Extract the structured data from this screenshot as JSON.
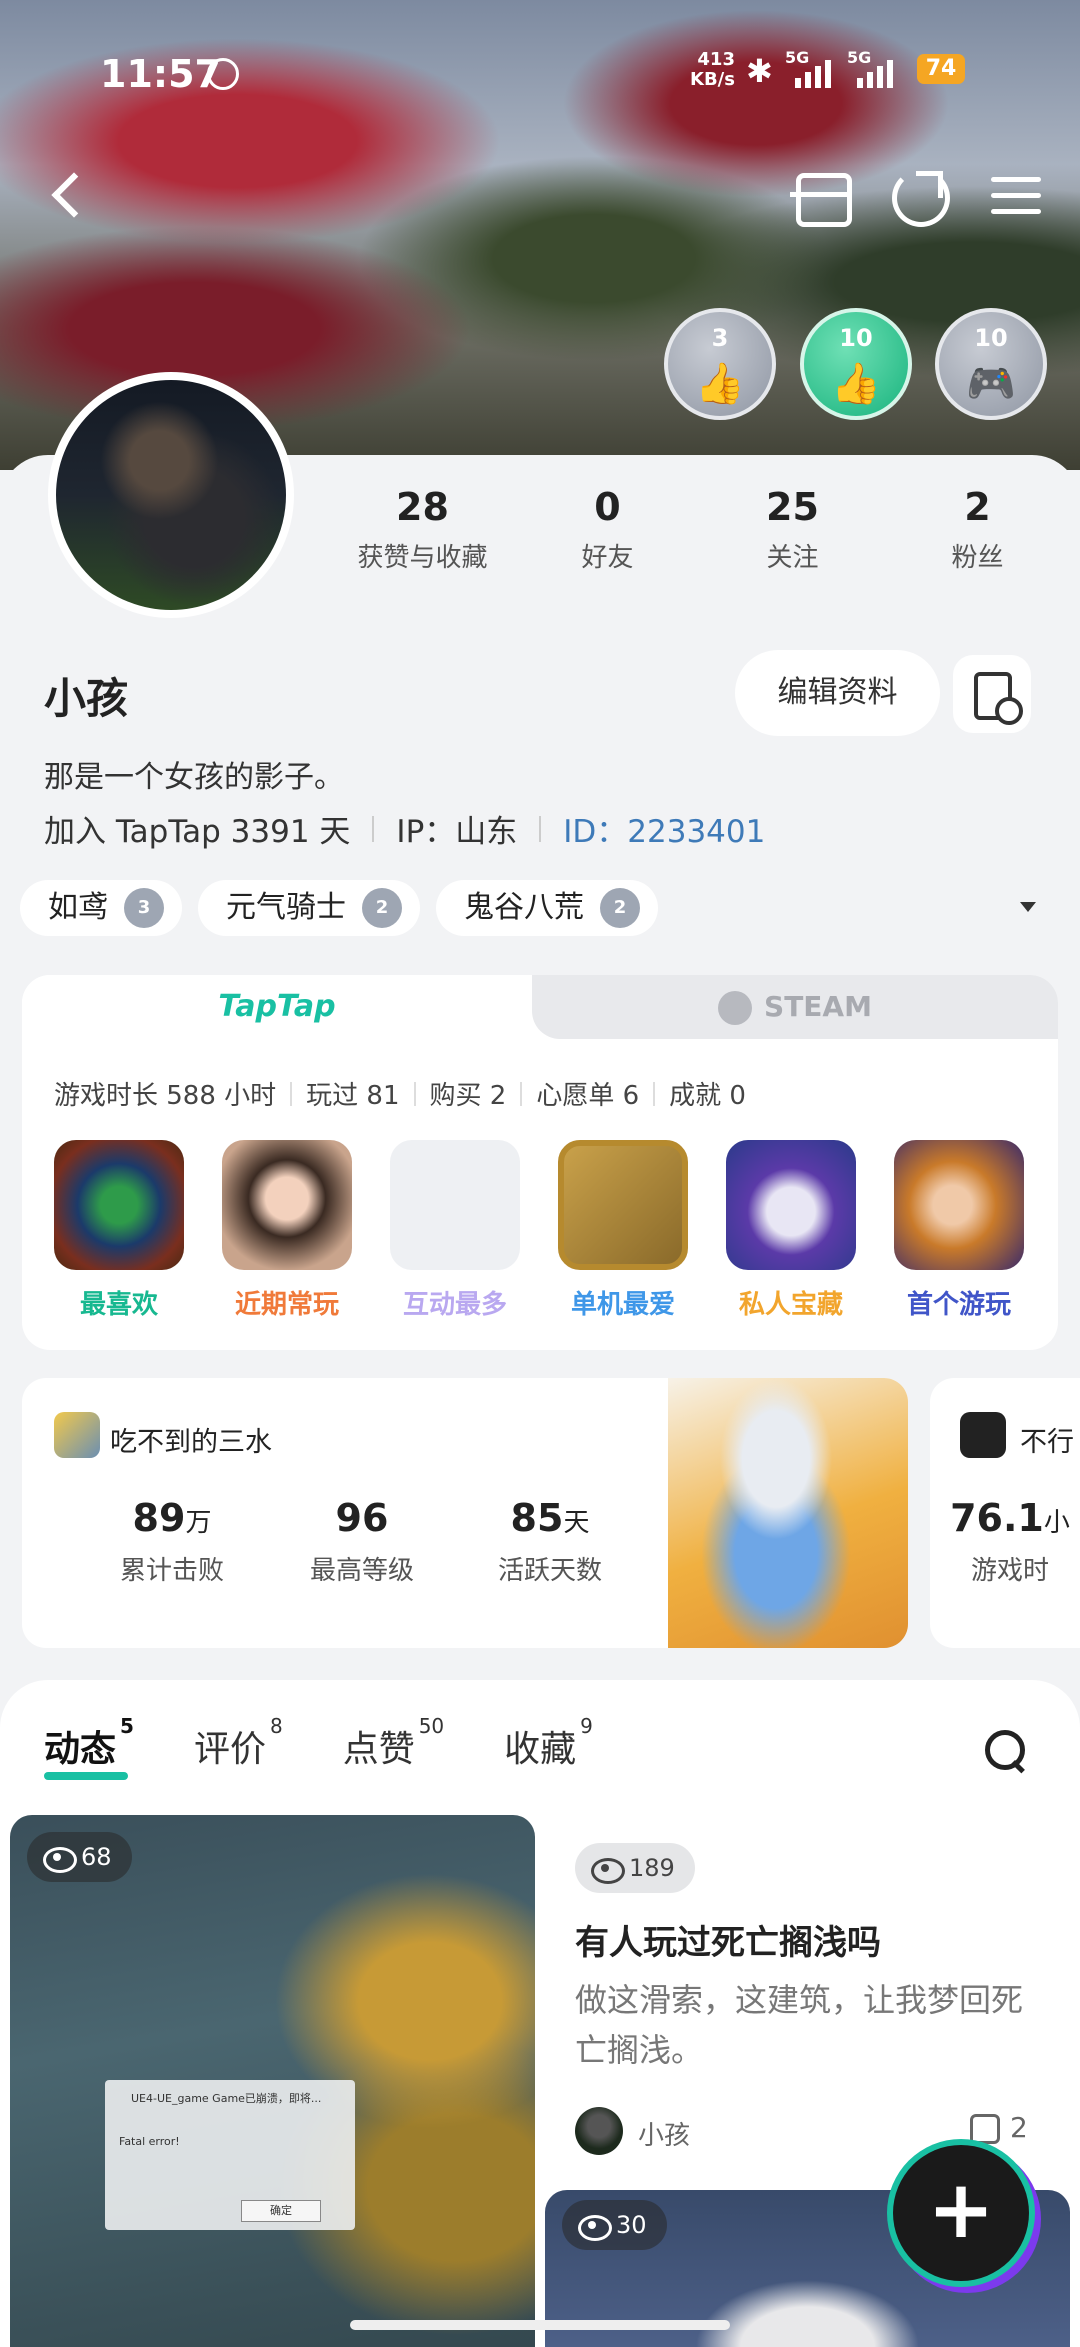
{
  "status": {
    "time": "11:57",
    "net_speed_top": "413",
    "net_speed_bottom": "KB/s",
    "sim1": "5G",
    "sim2": "5G",
    "battery": "74"
  },
  "badges": [
    {
      "num": "3",
      "icon": "thumbs-up-icon"
    },
    {
      "num": "10",
      "icon": "thumbs-up-icon"
    },
    {
      "num": "10",
      "icon": "gamepad-icon"
    }
  ],
  "stats": [
    {
      "value": "28",
      "label": "获赞与收藏"
    },
    {
      "value": "0",
      "label": "好友"
    },
    {
      "value": "25",
      "label": "关注"
    },
    {
      "value": "2",
      "label": "粉丝"
    }
  ],
  "profile": {
    "name": "小孩",
    "edit_label": "编辑资料",
    "bio": "那是一个女孩的影子。",
    "joined": "加入 TapTap 3391 天",
    "ip": "IP：山东",
    "id": "ID：2233401"
  },
  "tags": [
    {
      "label": "如鸢",
      "level": "3"
    },
    {
      "label": "元气骑士",
      "level": "2"
    },
    {
      "label": "鬼谷八荒",
      "level": "2"
    }
  ],
  "games": {
    "tab_taptap": "TapTap",
    "tab_steam": "STEAM",
    "playtime": "游戏时长 588 小时",
    "played": "玩过 81",
    "bought": "购买 2",
    "wishlist": "心愿单 6",
    "achievements": "成就 0",
    "items": [
      {
        "label": "最喜欢",
        "color": "#17b890"
      },
      {
        "label": "近期常玩",
        "color": "#f07a3a"
      },
      {
        "label": "互动最多",
        "color": "#b9a8f0"
      },
      {
        "label": "单机最爱",
        "color": "#3f97e8"
      },
      {
        "label": "私人宝藏",
        "color": "#f2a52d"
      },
      {
        "label": "首个游玩",
        "color": "#4055c8"
      }
    ]
  },
  "stat_cards": [
    {
      "game": "吃不到的三水",
      "blocks": [
        {
          "value": "89",
          "unit": "万",
          "label": "累计击败"
        },
        {
          "value": "96",
          "unit": "",
          "label": "最高等级"
        },
        {
          "value": "85",
          "unit": "天",
          "label": "活跃天数"
        }
      ]
    },
    {
      "game": "不行",
      "blocks": [
        {
          "value": "76.1",
          "unit": "小",
          "label": "游戏时"
        }
      ]
    }
  ],
  "feed_tabs": [
    {
      "label": "动态",
      "count": "5"
    },
    {
      "label": "评价",
      "count": "8"
    },
    {
      "label": "点赞",
      "count": "50"
    },
    {
      "label": "收藏",
      "count": "9"
    }
  ],
  "posts": [
    {
      "views": "68",
      "dialog_title": "UE4-UE_game Game已崩溃，即将...",
      "dialog_msg": "Fatal error!",
      "dialog_ok": "确定"
    },
    {
      "views": "189",
      "title": "有人玩过死亡搁浅吗",
      "excerpt": "做这滑索，这建筑，让我梦回死亡搁浅。",
      "author": "小孩",
      "likes": "2"
    },
    {
      "views": "30"
    }
  ],
  "fab_label": "+"
}
